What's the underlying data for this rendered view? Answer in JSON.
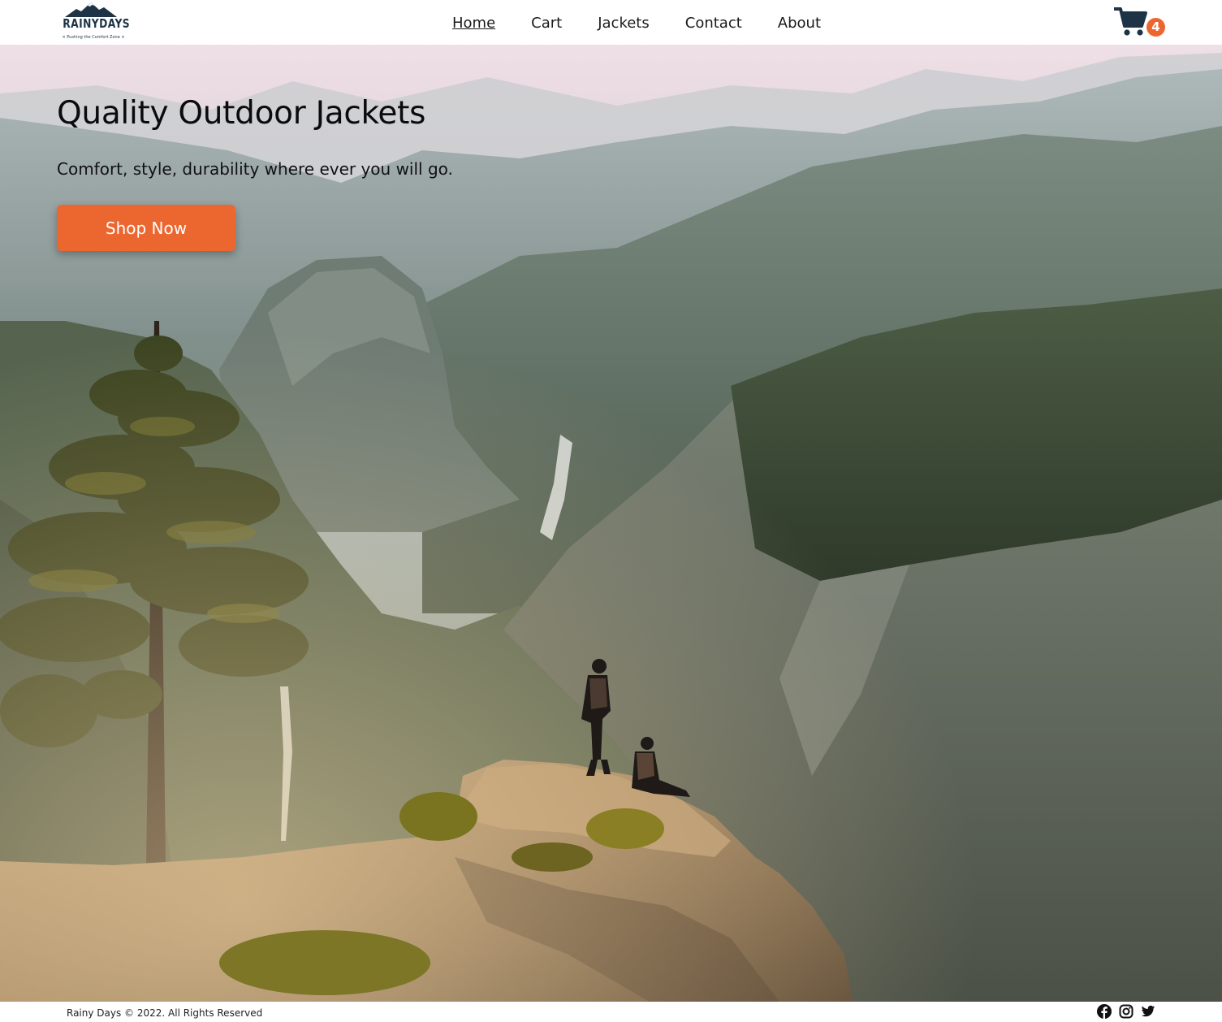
{
  "brand": {
    "name": "RAINYDAYS",
    "tagline": "× Pushing the Comfort Zone ×",
    "accent_color": "#ec6730",
    "dark_color": "#1e3446"
  },
  "nav": {
    "items": [
      {
        "label": "Home",
        "active": true
      },
      {
        "label": "Cart",
        "active": false
      },
      {
        "label": "Jackets",
        "active": false
      },
      {
        "label": "Contact",
        "active": false
      },
      {
        "label": "About",
        "active": false
      }
    ]
  },
  "cart": {
    "icon": "shopping-cart-icon",
    "count": "4"
  },
  "hero": {
    "title": "Quality Outdoor Jackets",
    "subtitle": "Comfort, style, durability where ever you will go.",
    "cta_label": "Shop Now",
    "background": "mountain-canyon-photo"
  },
  "footer": {
    "copyright": "Rainy Days © 2022. All Rights Reserved",
    "socials": [
      "facebook-icon",
      "instagram-icon",
      "twitter-icon"
    ]
  }
}
